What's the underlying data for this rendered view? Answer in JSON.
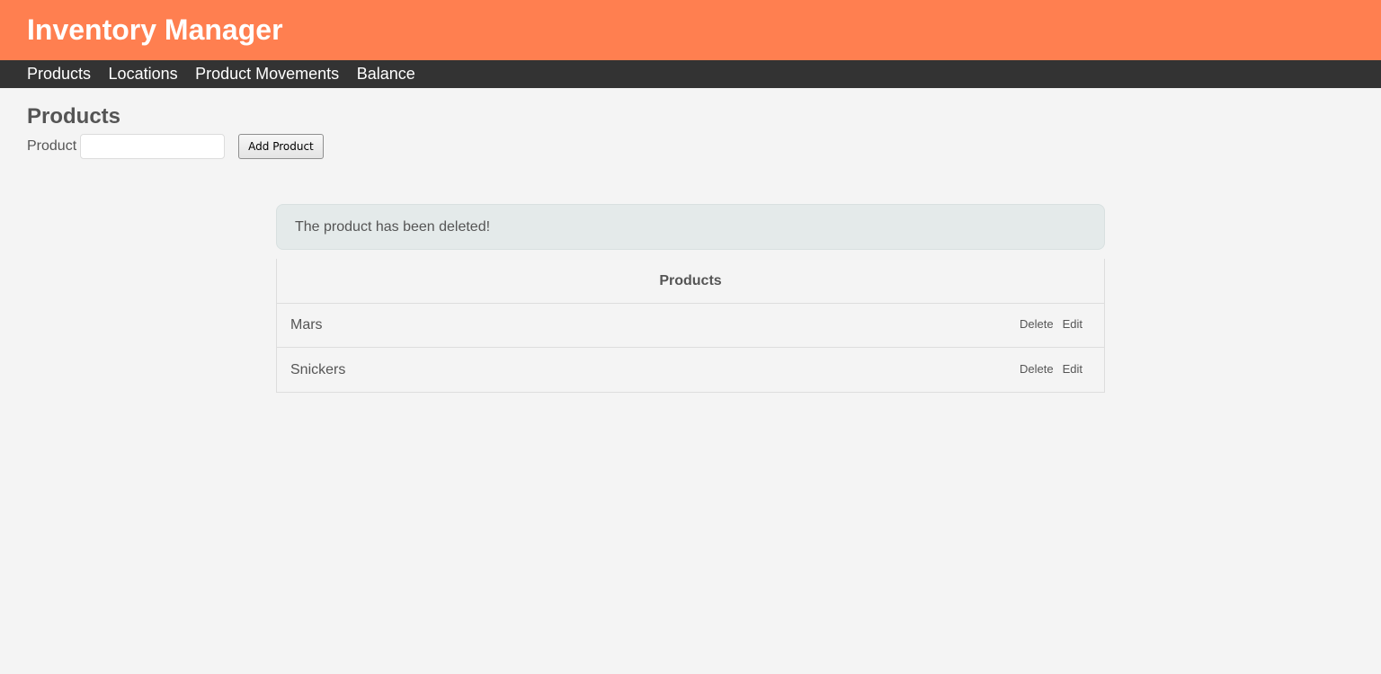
{
  "app": {
    "title": "Inventory Manager"
  },
  "nav": {
    "items": [
      {
        "label": "Products"
      },
      {
        "label": "Locations"
      },
      {
        "label": "Product Movements"
      },
      {
        "label": "Balance"
      }
    ]
  },
  "page": {
    "title": "Products"
  },
  "form": {
    "product_label": "Product",
    "product_value": "",
    "product_placeholder": "",
    "add_button_label": "Add Product"
  },
  "alert": {
    "message": "The product has been deleted!"
  },
  "table": {
    "header": "Products",
    "rows": [
      {
        "name": "Mars",
        "delete_label": "Delete",
        "edit_label": "Edit"
      },
      {
        "name": "Snickers",
        "delete_label": "Delete",
        "edit_label": "Edit"
      }
    ]
  },
  "colors": {
    "header_bg": "#ff7f50",
    "nav_bg": "#333333",
    "page_bg": "#f4f4f4",
    "alert_bg": "#e4eaea",
    "text": "#555555"
  }
}
